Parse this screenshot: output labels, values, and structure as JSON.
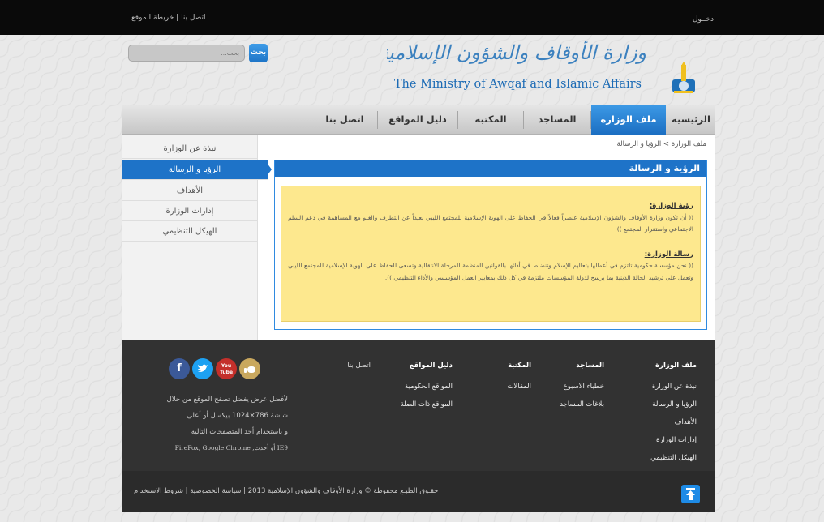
{
  "topbar": {
    "login": "دخــول",
    "contact": "اتصل بنا",
    "sitemap": "خريطة الموقع",
    "separator": "|"
  },
  "header": {
    "title_ar": "وزارة الأوقاف والشؤون الإسلامية",
    "title_en": "The Ministry of Awqaf and Islamic Affairs"
  },
  "search": {
    "placeholder": "بحث...",
    "button": "بحث"
  },
  "nav": {
    "items": [
      {
        "label": "الرئيسية"
      },
      {
        "label": "ملف الوزارة",
        "active": true
      },
      {
        "label": "المساجد"
      },
      {
        "label": "المكتبة"
      },
      {
        "label": "دليل المواقع"
      },
      {
        "label": "اتصل بنا"
      }
    ]
  },
  "sidebar": {
    "items": [
      {
        "label": "نبذة عن الوزارة"
      },
      {
        "label": "الرؤيا و الرسالة",
        "active": true
      },
      {
        "label": "الأهداف"
      },
      {
        "label": "إدارات الوزارة"
      },
      {
        "label": "الهيكل التنظيمي"
      }
    ]
  },
  "breadcrumb": {
    "parent": "ملف الوزارة",
    "separator": ">",
    "current": "الرؤيا و الرسالة"
  },
  "panel": {
    "title": "الرؤية و الرسالة",
    "vision_heading": "رؤية الوزارة:",
    "vision_text": "(( أن تكون وزارة الأوقاف والشؤون الإسلامية عنصراً فعالاً في الحفاظ على الهوية الإسلامية للمجتمع الليبي بعيداً عن التطرف والغلو مع المساهمة في دعم السلم الاجتماعي واستقرار المجتمع )).",
    "mission_heading": "رسالة الوزارة:",
    "mission_text": "(( نحن مؤسسة حكومية تلتزم في أعمالها بتعاليم الإسلام وتنضبط في أدائها بالقوانين المنظمة للمرحلة الانتقالية وتسعى للحفاظ على الهوية الإسلامية للمجتمع الليبي وتعمل على ترشيد الحالة الدينية بما يرسخ لدولة المؤسسات ملتزمة في كل ذلك بمعايير العمل المؤسسي والأداء التنظيمي ))."
  },
  "footer": {
    "columns": [
      {
        "heading": "ملف الوزارة",
        "links": [
          "نبذة عن الوزارة",
          "الرؤيا و الرسالة",
          "الأهداف",
          "إدارات الوزارة",
          "الهيكل التنظيمي"
        ]
      },
      {
        "heading": "المساجد",
        "links": [
          "خطباء الاسبوع",
          "بلاغات المساجد"
        ]
      },
      {
        "heading": "المكتبة",
        "links": [
          "المقالات"
        ]
      },
      {
        "heading": "دليل المواقع",
        "links": [
          "المواقع الحكومية",
          "المواقع ذات الصلة"
        ]
      },
      {
        "heading": "اتصل بنا",
        "links": []
      }
    ],
    "info": {
      "line1": "لأفضل عرض يفضل تصفح الموقع من خلال",
      "line2": "شاشة 786×1024 بيكسل أو أعلى",
      "line3": "و باستخدام أحد المتصفحات التالية",
      "line4": "IE9 أو أحدث, FireFox, Google Chrome"
    },
    "social": {
      "facebook": "f",
      "youtube_top": "You",
      "youtube_bottom": "Tube"
    }
  },
  "bottom": {
    "terms": "شروط الاستخدام",
    "privacy": "سياسة الخصوصية",
    "copyright": "حقـوق الطبـع محفوظة © وزارة الأوقاف والشؤون الإسلامية 2013",
    "separator": "|"
  },
  "colors": {
    "accent": "#1e73c8",
    "highlight": "#fde88e",
    "footer": "#323232"
  }
}
